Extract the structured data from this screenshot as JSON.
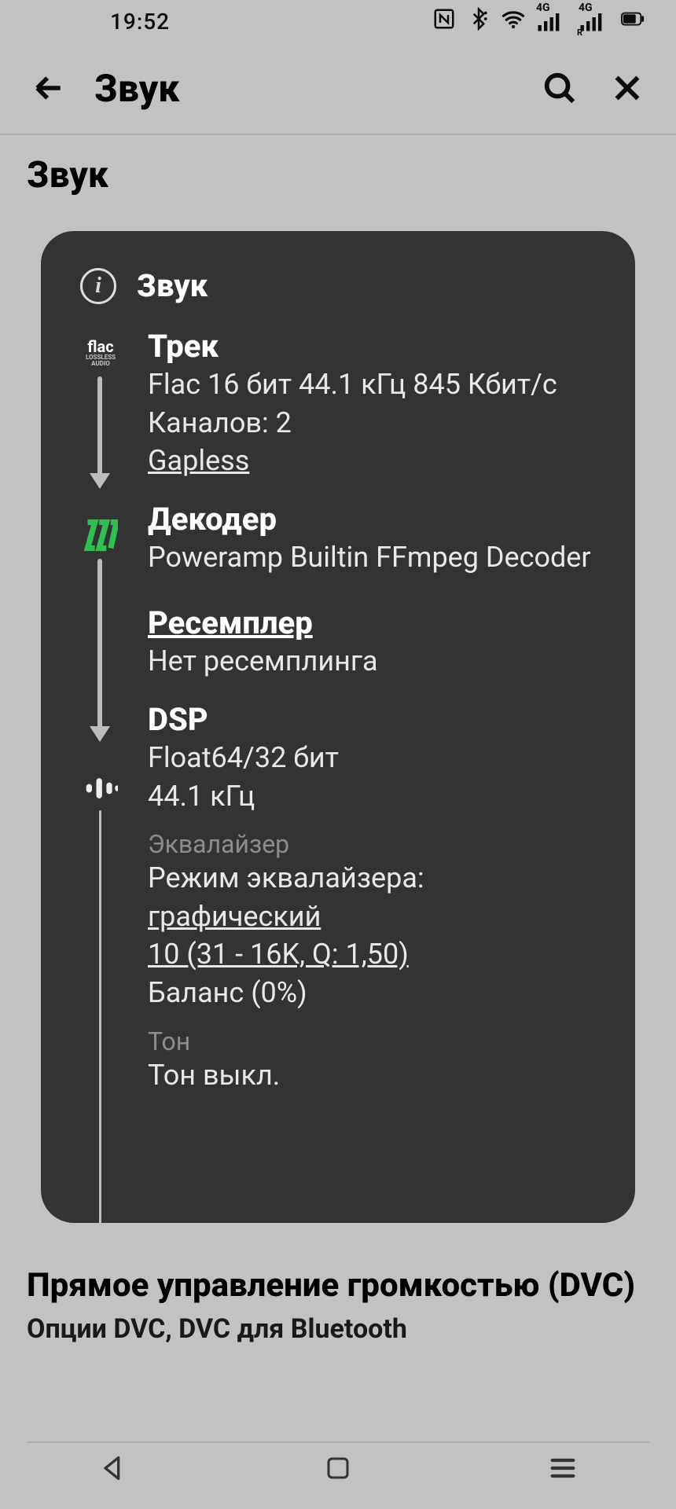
{
  "statusbar": {
    "time": "19:52"
  },
  "header": {
    "title": "Звук"
  },
  "content": {
    "section_title": "Звук",
    "dvc": {
      "title": "Прямое управление громкостью (DVC)",
      "sub": "Опции DVC, DVC для Bluetooth"
    }
  },
  "dialog": {
    "title": "Звук",
    "track": {
      "title": "Трек",
      "format": "Flac 16 бит 44.1 кГц 845 Кбит/с",
      "channels": "Каналов: 2",
      "gapless": "Gapless"
    },
    "decoder": {
      "title": "Декодер",
      "name": "Poweramp Builtin FFmpeg Decoder"
    },
    "resampler": {
      "title": "Ресемплер",
      "status": "Нет ресемплинга"
    },
    "dsp": {
      "title": "DSP",
      "format": "Float64/32 бит",
      "rate": "44.1 кГц",
      "eq_label": "Эквалайзер",
      "eq_mode_label": "Режим эквалайзера:",
      "eq_mode": "графический",
      "eq_bands": "10 (31 - 16K, Q: 1,50)",
      "balance": "Баланс (0%)",
      "tone_label": "Тон",
      "tone_status": "Тон выкл."
    }
  }
}
